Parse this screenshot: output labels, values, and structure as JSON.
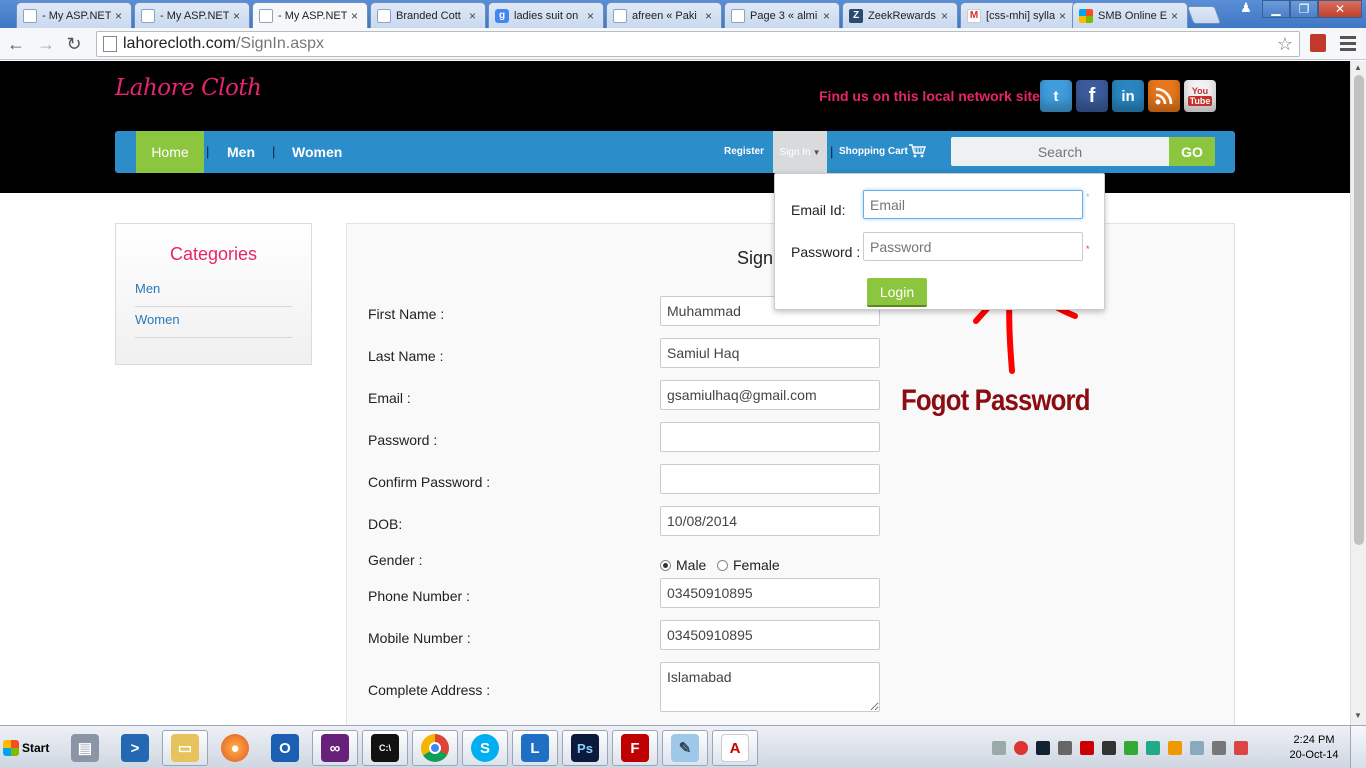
{
  "browser": {
    "tabs": [
      {
        "label": "- My ASP.NET",
        "favicon": "doc",
        "active": false
      },
      {
        "label": "- My ASP.NET",
        "favicon": "doc",
        "active": false
      },
      {
        "label": "- My ASP.NET",
        "favicon": "doc",
        "active": true
      },
      {
        "label": "Branded Cott",
        "favicon": "doc",
        "active": false
      },
      {
        "label": "ladies suit on",
        "favicon": "g",
        "active": false
      },
      {
        "label": "afreen « Paki",
        "favicon": "doc",
        "active": false
      },
      {
        "label": "Page 3 « almi",
        "favicon": "doc",
        "active": false
      },
      {
        "label": "ZeekRewards",
        "favicon": "z",
        "active": false
      },
      {
        "label": "[css-mhi] sylla",
        "favicon": "m",
        "active": false
      },
      {
        "label": "SMB Online E",
        "favicon": "ms",
        "active": false
      }
    ],
    "url_host": "lahorecloth.com",
    "url_path": "/SignIn.aspx"
  },
  "site": {
    "logo": "Lahore Cloth",
    "find_us": "Find us on this local network sites",
    "social": {
      "twitter": "t",
      "facebook": "f",
      "linkedin": "in",
      "rss": "rss",
      "youtube_top": "You",
      "youtube_bottom": "Tube"
    },
    "nav": {
      "home": "Home",
      "men": "Men",
      "women": "Women",
      "sep": "|",
      "register": "Register",
      "signin": "Sign In",
      "cart": "Shopping Cart"
    },
    "search": {
      "placeholder": "Search",
      "go": "GO"
    }
  },
  "sidebar": {
    "title": "Categories",
    "items": [
      "Men",
      "Women"
    ]
  },
  "form": {
    "title": "Sign",
    "fields": {
      "first_name": {
        "label": "First Name :",
        "value": "Muhammad"
      },
      "last_name": {
        "label": "Last Name :",
        "value": "Samiul Haq"
      },
      "email": {
        "label": "Email :",
        "value": "gsamiulhaq@gmail.com"
      },
      "password": {
        "label": "Password :",
        "value": ""
      },
      "confirm_password": {
        "label": "Confirm Password :",
        "value": ""
      },
      "dob": {
        "label": "DOB:",
        "value": "10/08/2014"
      },
      "gender": {
        "label": "Gender :",
        "options": [
          "Male",
          "Female"
        ],
        "selected": "Male"
      },
      "phone": {
        "label": "Phone Number :",
        "value": "03450910895"
      },
      "mobile": {
        "label": "Mobile Number :",
        "value": "03450910895"
      },
      "address": {
        "label": "Complete Address :",
        "value": "Islamabad"
      }
    }
  },
  "login_popup": {
    "email_label": "Email Id:",
    "email_placeholder": "Email",
    "password_label": "Password :",
    "password_placeholder": "Password",
    "required_mark": "*",
    "login_button": "Login"
  },
  "annotation": {
    "text": "Fogot Password",
    "color": "#8b0d14",
    "arrow_color": "#ff0000"
  },
  "taskbar": {
    "start": "Start",
    "apps": [
      "server-manager",
      "powershell",
      "file-explorer",
      "firefox",
      "outlook",
      "visual-studio",
      "command-prompt",
      "chrome",
      "skype",
      "lync",
      "photoshop",
      "filezilla",
      "notepad",
      "acrobat"
    ],
    "clock_time": "2:24 PM",
    "clock_date": "20-Oct-14"
  },
  "colors": {
    "brand_pink": "#e8246e",
    "nav_blue": "#2b8dc9",
    "accent_green": "#8cc63f"
  }
}
